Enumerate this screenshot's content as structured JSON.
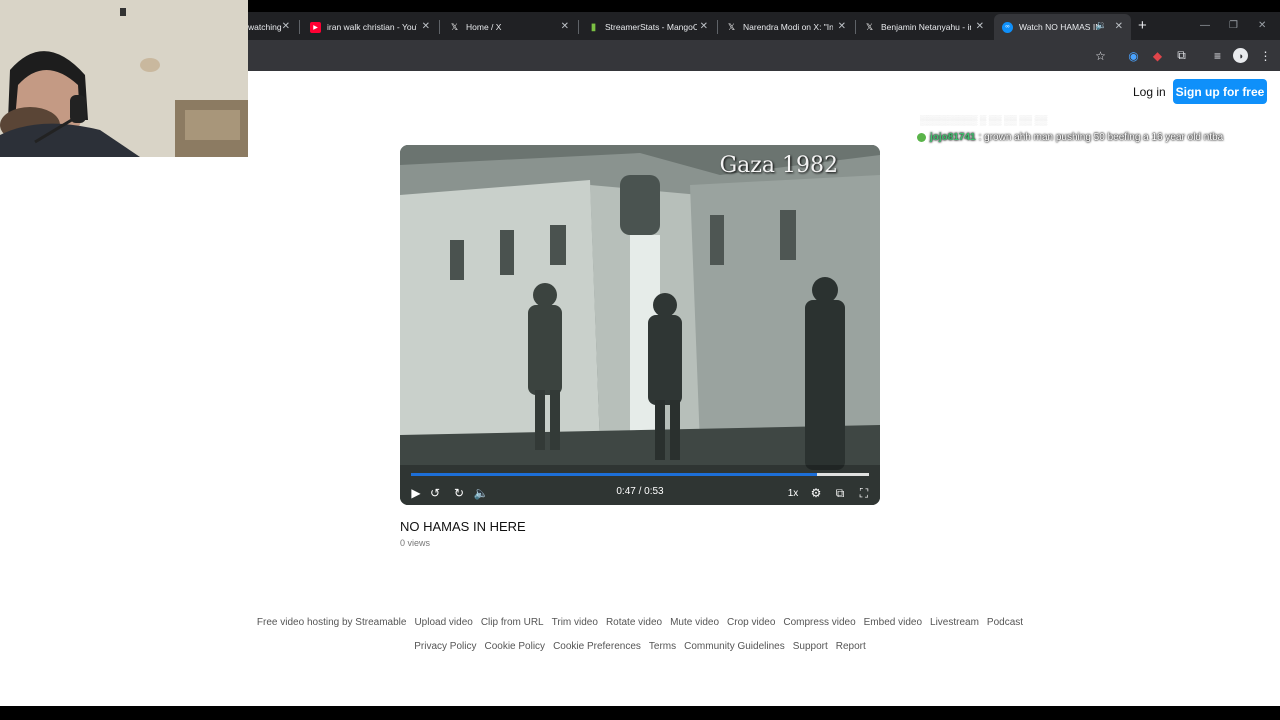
{
  "browser": {
    "tabs": [
      {
        "label": "watching",
        "icon": "page-icon",
        "color": "#9aa0a6"
      },
      {
        "label": "iran walk christian - YouTube",
        "icon": "youtube-icon",
        "color": "#ff0033"
      },
      {
        "label": "Home / X",
        "icon": "x-logo-icon",
        "color": "#ffffff"
      },
      {
        "label": "StreamerStats - MangoCu",
        "icon": "bar-chart-icon",
        "color": "#7bc043"
      },
      {
        "label": "Narendra Modi on X: \"In",
        "icon": "x-logo-icon",
        "color": "#ffffff"
      },
      {
        "label": "Benjamin Netanyahu - in",
        "icon": "x-logo-icon",
        "color": "#ffffff"
      },
      {
        "label": "Watch NO HAMAS IN",
        "icon": "streamable-icon",
        "color": "#0f90fa"
      }
    ],
    "close_glyph": "✕",
    "new_tab_glyph": "+",
    "window": {
      "minimize": "—",
      "restore": "❐",
      "close": "✕"
    }
  },
  "header": {
    "login": "Log in",
    "signup": "Sign up for free"
  },
  "chat": {
    "username": "jojo81741",
    "message": ": grown ahh man pushing 50 beefing a 16 year old ntba"
  },
  "video": {
    "overlay_text": "Gaza 1982",
    "current_time": "0:47",
    "duration": "0:53",
    "time_display": "0:47 / 0:53",
    "progress_fraction": 0.887,
    "speed": "1x",
    "title": "NO HAMAS IN HERE",
    "views": "0 views"
  },
  "footer": {
    "row1": [
      "Free video hosting by Streamable",
      "Upload video",
      "Clip from URL",
      "Trim video",
      "Rotate video",
      "Mute video",
      "Crop video",
      "Compress video",
      "Embed video",
      "Livestream",
      "Podcast"
    ],
    "row2": [
      "Privacy Policy",
      "Cookie Policy",
      "Cookie Preferences",
      "Terms",
      "Community Guidelines",
      "Support",
      "Report"
    ]
  },
  "colors": {
    "accent": "#0f90fa",
    "progress": "#1d6fd8",
    "chat_username": "#3fbf6e"
  }
}
